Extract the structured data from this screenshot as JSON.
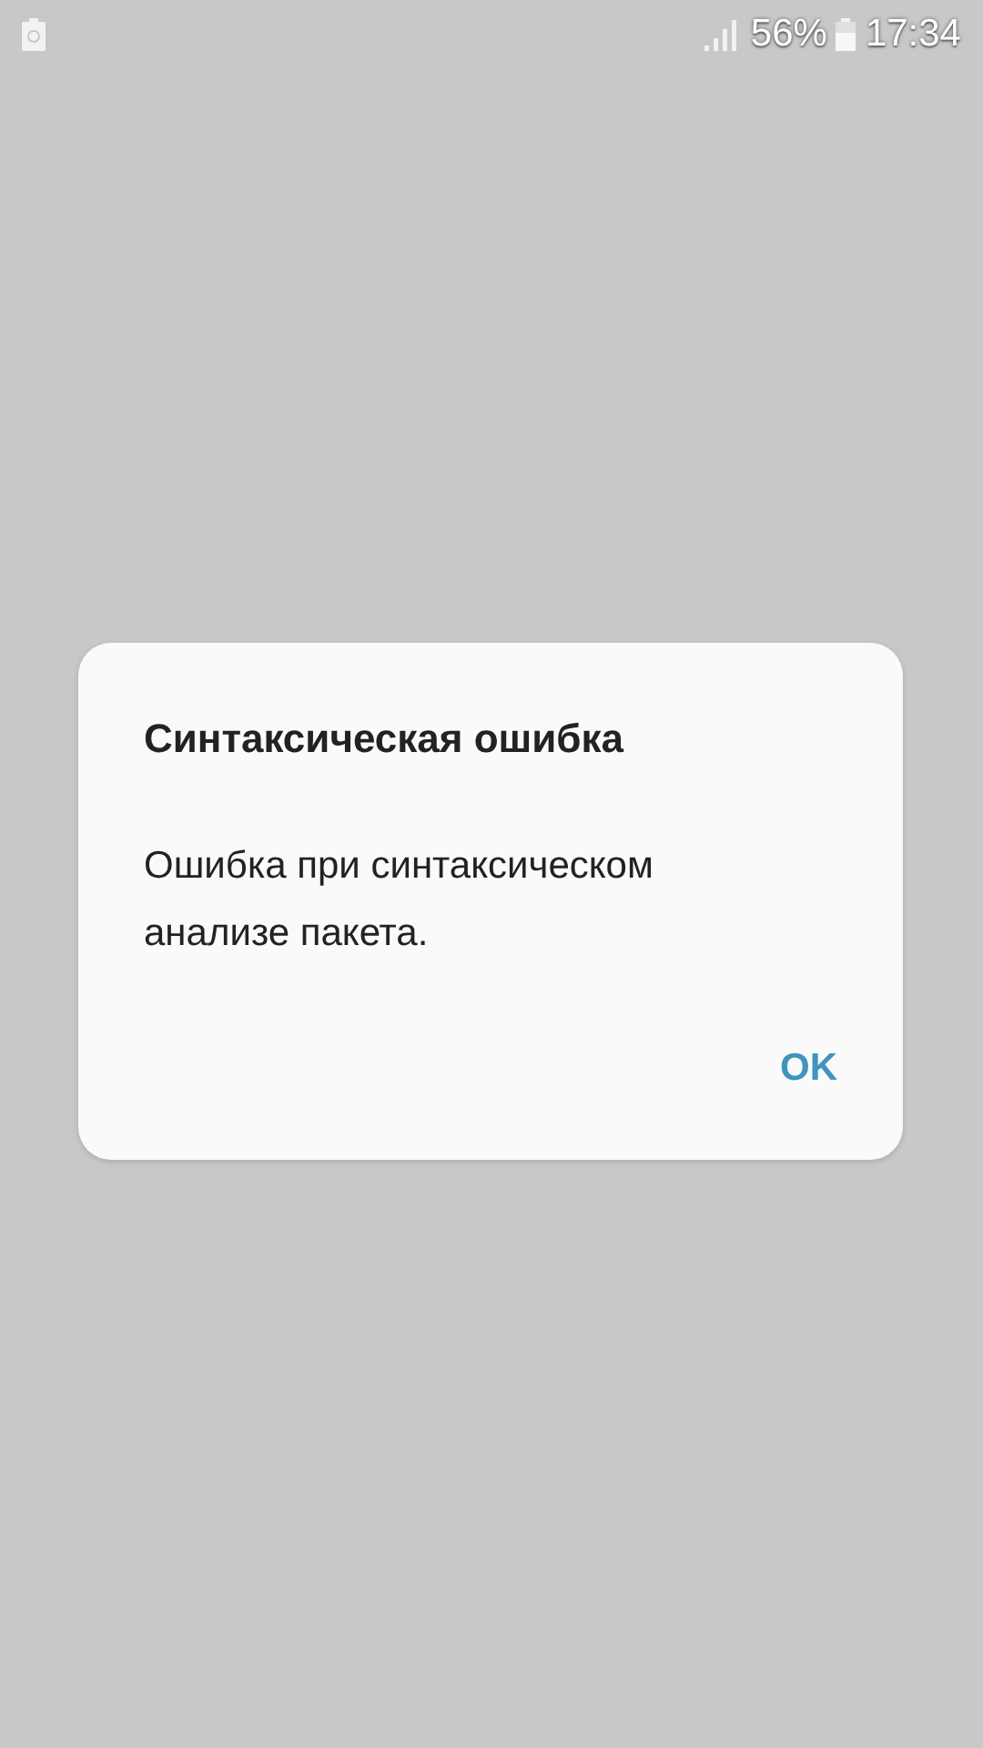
{
  "status_bar": {
    "battery_percent": "56%",
    "time": "17:34"
  },
  "dialog": {
    "title": "Синтаксическая ошибка",
    "message": "Ошибка при синтаксическом анализе пакета.",
    "buttons": [
      "OK"
    ]
  }
}
